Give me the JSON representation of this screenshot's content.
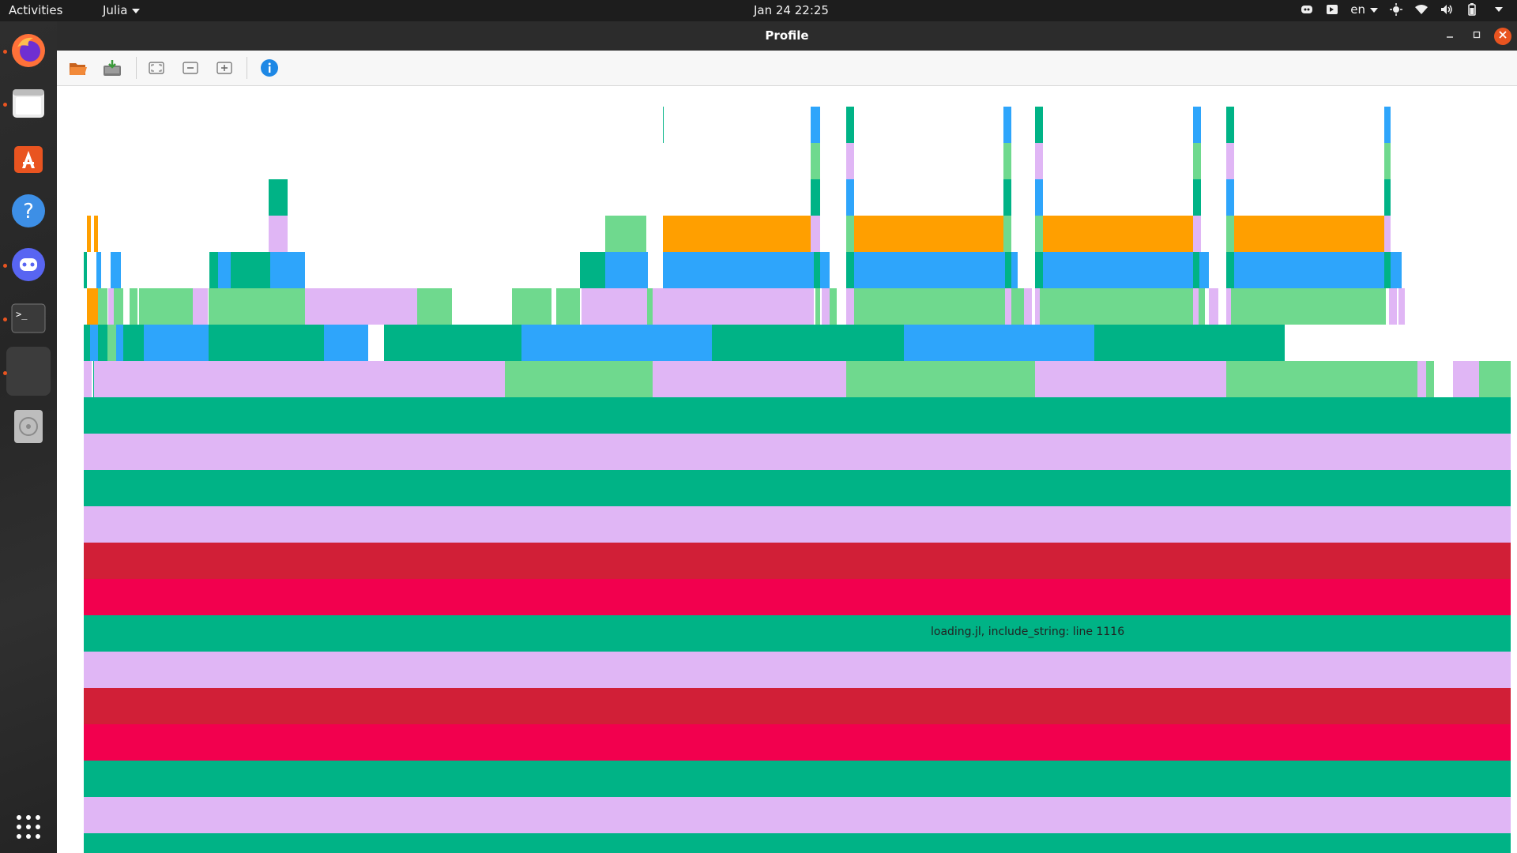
{
  "topbar": {
    "activities": "Activities",
    "app_menu": "Julia",
    "clock": "Jan 24  22:25",
    "language": "en"
  },
  "dock": {
    "items": [
      "firefox-icon",
      "files-icon",
      "software-icon",
      "help-icon",
      "discord-icon",
      "terminal-icon",
      "julia-window-icon",
      "optical-disk-icon"
    ],
    "show_apps": "show-applications-icon"
  },
  "window": {
    "title": "Profile"
  },
  "toolbar": {
    "buttons": [
      "open-icon",
      "save-icon",
      "zoom-fit-icon",
      "zoom-out-icon",
      "zoom-in-icon",
      "info-icon"
    ]
  },
  "flamegraph": {
    "hover_label": "loading.jl, include_string: line 1116",
    "palette": {
      "teal": "#00b386",
      "lavender": "#e0b6f5",
      "green": "#6fd98e",
      "blue": "#2ea5fb",
      "orange": "#ff9f00",
      "crimson": "#d11f37",
      "red": "#f2004e"
    }
  }
}
